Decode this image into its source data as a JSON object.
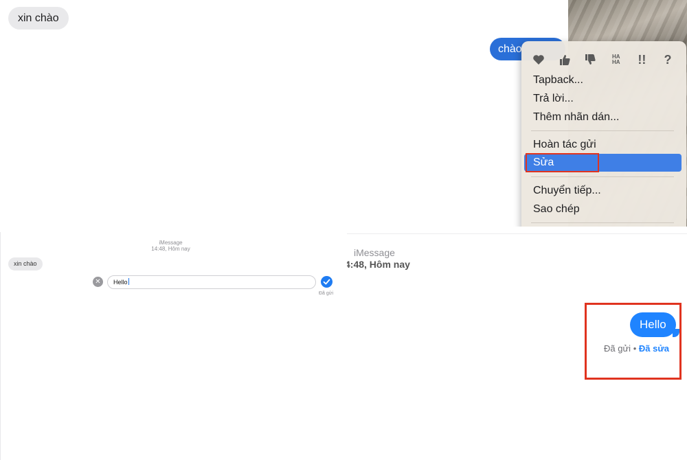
{
  "top_panel": {
    "incoming_message": "xin chào",
    "outgoing_message_visible": "chào",
    "tapback": {
      "icons": [
        "heart-icon",
        "thumbs-up-icon",
        "thumbs-down-icon",
        "haha-icon",
        "exclamation-icon",
        "question-icon"
      ],
      "haha_label": "HA HA",
      "exclaim_label": "!!",
      "question_label": "?"
    },
    "menu": {
      "items": [
        "Tapback...",
        "Trả lời...",
        "Thêm nhãn dán...",
        "Hoàn tác gửi",
        "Sửa",
        "Chuyển tiếp...",
        "Sao chép"
      ],
      "selected": "Sửa"
    },
    "colors": {
      "selected": "#3f7fe6",
      "highlight_box": "#e0331f",
      "outgoing_bubble": "#2a6fd8"
    }
  },
  "edit_panel": {
    "service": "iMessage",
    "timestamp": "14:48, Hôm nay",
    "incoming_message": "xin chào",
    "edit_field_value": "Hello",
    "status": "Đã gửi"
  },
  "result_panel": {
    "service": "iMessage",
    "timestamp": "4:48, Hôm nay",
    "message": "Hello",
    "status_sent": "Đã gửi",
    "separator": "•",
    "status_edited": "Đã sửa",
    "colors": {
      "bubble": "#1f84ff"
    }
  }
}
